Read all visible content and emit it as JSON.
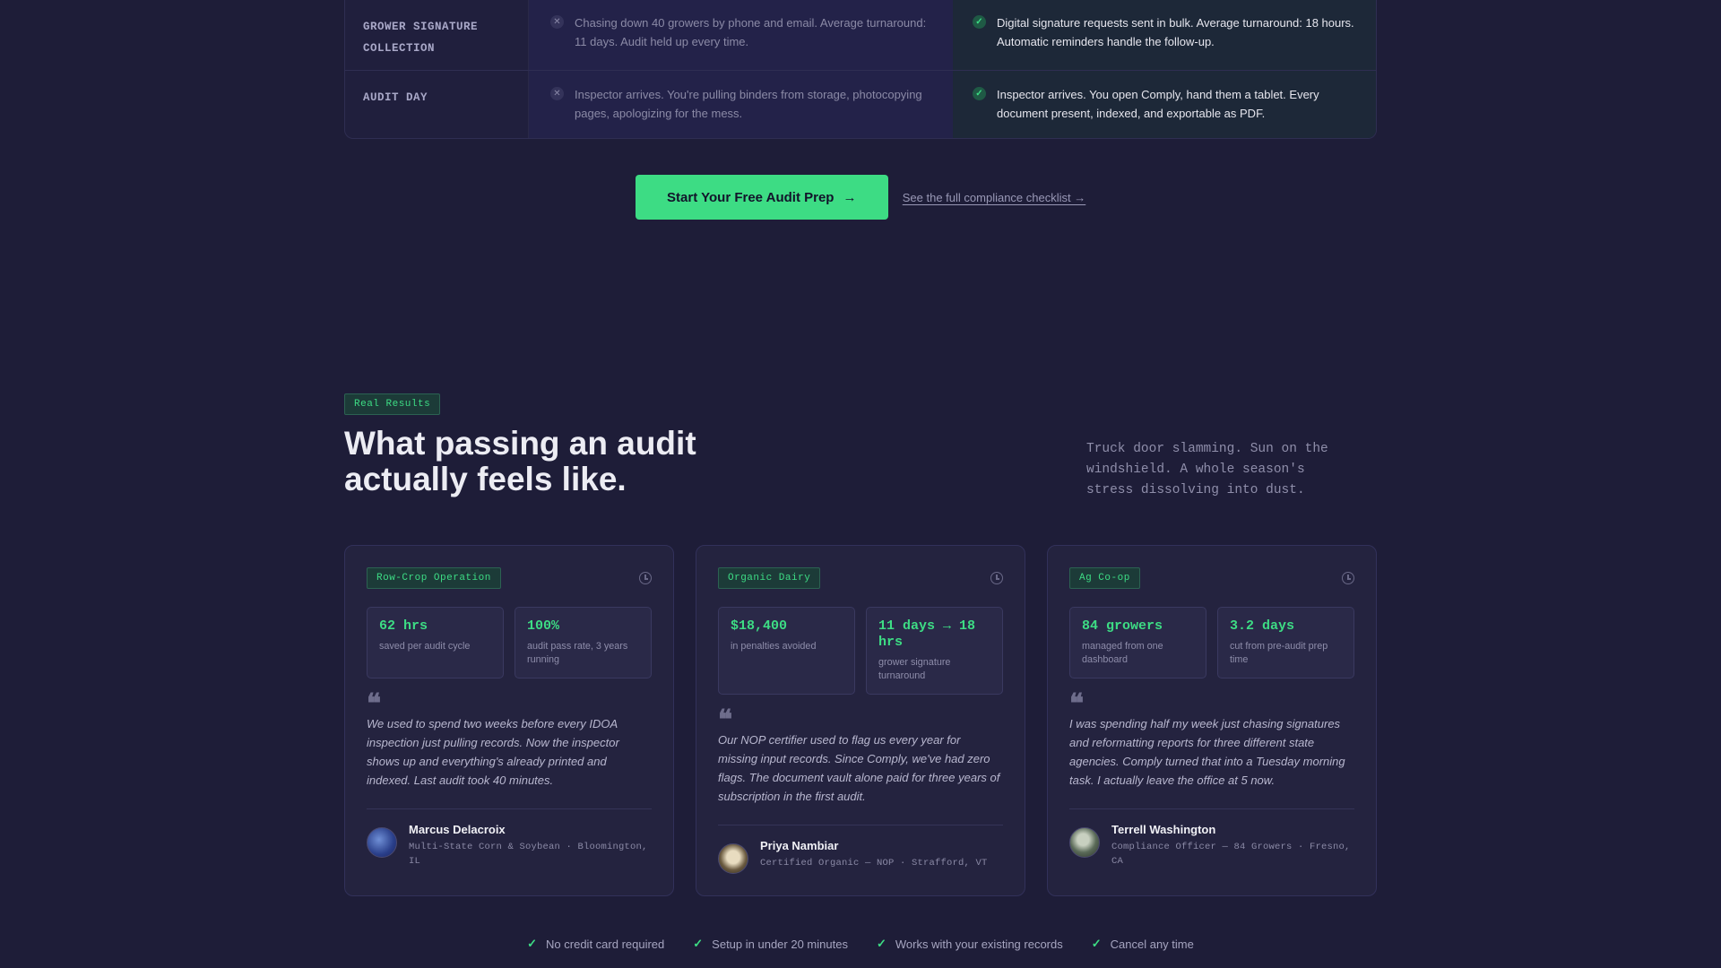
{
  "comparison": {
    "rows": [
      {
        "label": "GROWER SIGNATURE COLLECTION",
        "before": "Chasing down 40 growers by phone and email. Average turnaround: 11 days. Audit held up every time.",
        "after": "Digital signature requests sent in bulk. Average turnaround: 18 hours. Automatic reminders handle the follow-up."
      },
      {
        "label": "AUDIT DAY",
        "before": "Inspector arrives. You're pulling binders from storage, photocopying pages, apologizing for the mess.",
        "after": "Inspector arrives. You open Comply, hand them a tablet. Every document present, indexed, and exportable as PDF."
      }
    ]
  },
  "cta": {
    "primary_label": "Start Your Free Audit Prep",
    "primary_arrow": "→",
    "secondary_label": "See the full compliance checklist →"
  },
  "results": {
    "badge": "Real Results",
    "heading": "What passing an audit actually feels like.",
    "aside": "Truck door slamming. Sun on the windshield. A whole season's stress dissolving into dust."
  },
  "testimonials": [
    {
      "tag": "Row-Crop Operation",
      "stats": [
        {
          "value": "62 hrs",
          "label": "saved per audit cycle"
        },
        {
          "value": "100%",
          "label": "audit pass rate, 3 years running"
        }
      ],
      "quote": "We used to spend two weeks before every IDOA inspection just pulling records. Now the inspector shows up and everything's already printed and indexed. Last audit took 40 minutes.",
      "name": "Marcus Delacroix",
      "meta": "Multi-State Corn & Soybean · Bloomington, IL"
    },
    {
      "tag": "Organic Dairy",
      "stats": [
        {
          "value": "$18,400",
          "label": "in penalties avoided"
        },
        {
          "value": "11 days → 18 hrs",
          "label": "grower signature turnaround"
        }
      ],
      "quote": "Our NOP certifier used to flag us every year for missing input records. Since Comply, we've had zero flags. The document vault alone paid for three years of subscription in the first audit.",
      "name": "Priya Nambiar",
      "meta": "Certified Organic — NOP · Strafford, VT"
    },
    {
      "tag": "Ag Co-op",
      "stats": [
        {
          "value": "84 growers",
          "label": "managed from one dashboard"
        },
        {
          "value": "3.2 days",
          "label": "cut from pre-audit prep time"
        }
      ],
      "quote": "I was spending half my week just chasing signatures and reformatting reports for three different state agencies. Comply turned that into a Tuesday morning task. I actually leave the office at 5 now.",
      "name": "Terrell Washington",
      "meta": "Compliance Officer — 84 Growers · Fresno, CA"
    }
  ],
  "trust": [
    "No credit card required",
    "Setup in under 20 minutes",
    "Works with your existing records",
    "Cancel any time"
  ],
  "icons": {
    "x": "✕",
    "check": "✓",
    "quote": "❝"
  },
  "colors": {
    "accent": "#3ddc84",
    "background": "#1e1d38",
    "card": "#24233f"
  }
}
